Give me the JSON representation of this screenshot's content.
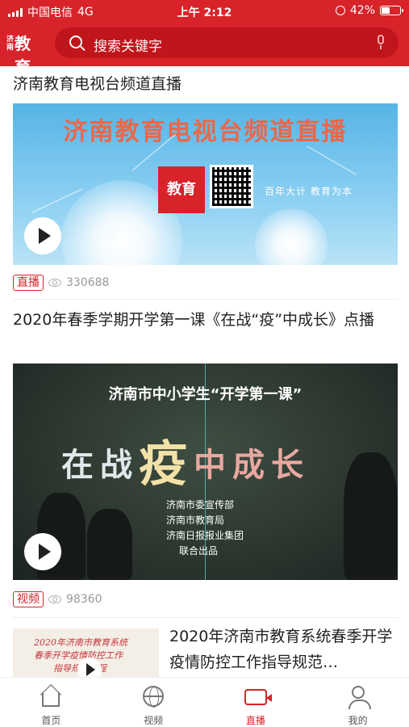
{
  "status_bar": {
    "carrier": "中国电信",
    "network": "4G",
    "time": "上午 2:12",
    "battery_text": "42%",
    "battery_level": 0.42
  },
  "header": {
    "logo_text": "教育",
    "search_placeholder": "搜索关键字",
    "icons": [
      "search-icon",
      "mic-icon"
    ]
  },
  "feed": [
    {
      "title": "济南教育电视台频道直播",
      "thumb_headline": "济南教育电视台频道直播",
      "thumb_badge": "教育",
      "thumb_slogan": "百年大计 教育为本",
      "tag": "直播",
      "views": "330688"
    },
    {
      "title": "2020年春季学期开学第一课《在战“疫”中成长》点播",
      "thumb_top_line": "济南市中小学生“开学第一课”",
      "thumb_big_1": "在战",
      "thumb_big_2": "疫",
      "thumb_big_3": "中成长",
      "credits": [
        "济南市委宣传部",
        "济南市教育局",
        "济南日报报业集团",
        "联合出品"
      ],
      "tag": "视频",
      "views": "98360"
    },
    {
      "title": "2020年济南市教育系统春季开学疫情防控工作指导规范…",
      "thumb_text": [
        "2020年济南市教育系统",
        "春季开学疫情防控工作",
        "指导规范流程"
      ]
    }
  ],
  "tabs": [
    {
      "label": "首页",
      "icon": "home-icon",
      "active": false
    },
    {
      "label": "视频",
      "icon": "globe-icon",
      "active": false
    },
    {
      "label": "直播",
      "icon": "live-camera-icon",
      "active": true
    },
    {
      "label": "我的",
      "icon": "profile-icon",
      "active": false
    }
  ],
  "colors": {
    "brand_red": "#d8232a",
    "text": "#222222",
    "muted": "#999999"
  }
}
